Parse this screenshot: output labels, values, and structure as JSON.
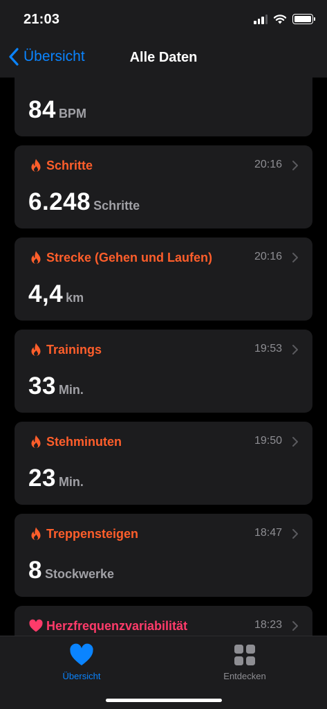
{
  "status_bar": {
    "time": "21:03"
  },
  "nav": {
    "back_label": "Übersicht",
    "title": "Alle Daten"
  },
  "colors": {
    "activity": "#ff5e2b",
    "heart": "#ff3b6a",
    "accent": "#0a84ff",
    "inactive_tab": "#8e8e93"
  },
  "cards": [
    {
      "title": "",
      "icon": "heart-icon",
      "time": "",
      "value": "84",
      "unit": "BPM"
    },
    {
      "title": "Schritte",
      "icon": "flame-icon",
      "time": "20:16",
      "value": "6.248",
      "unit": "Schritte"
    },
    {
      "title": "Strecke (Gehen und Laufen)",
      "icon": "flame-icon",
      "time": "20:16",
      "value": "4,4",
      "unit": "km"
    },
    {
      "title": "Trainings",
      "icon": "flame-icon",
      "time": "19:53",
      "value": "33",
      "unit": "Min."
    },
    {
      "title": "Stehminuten",
      "icon": "flame-icon",
      "time": "19:50",
      "value": "23",
      "unit": "Min."
    },
    {
      "title": "Treppensteigen",
      "icon": "flame-icon",
      "time": "18:47",
      "value": "8",
      "unit": "Stockwerke"
    },
    {
      "title": "Herzfrequenzvariabilität",
      "icon": "heart-icon",
      "time": "18:23",
      "value": "",
      "unit": ""
    }
  ],
  "tabs": [
    {
      "label": "Übersicht",
      "icon": "heart-icon",
      "selected": true
    },
    {
      "label": "Entdecken",
      "icon": "grid-icon",
      "selected": false
    }
  ]
}
